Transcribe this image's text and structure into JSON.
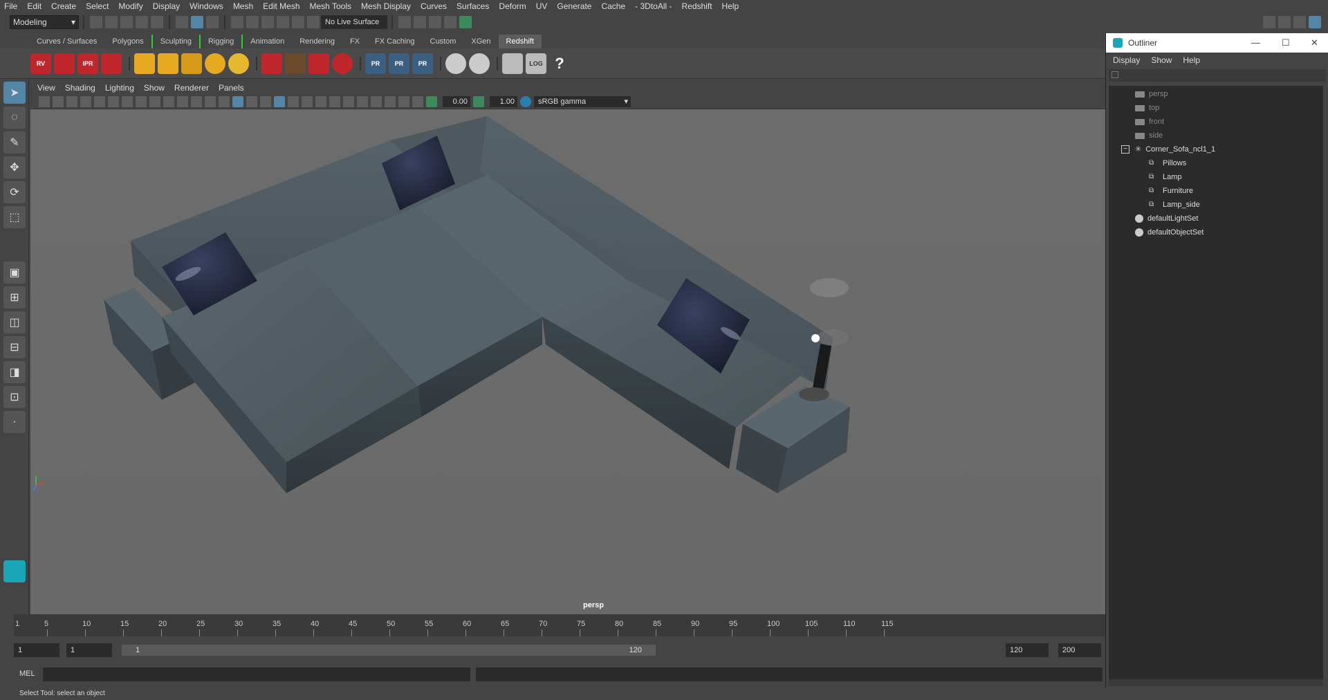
{
  "menubar": [
    "File",
    "Edit",
    "Create",
    "Select",
    "Modify",
    "Display",
    "Windows",
    "Mesh",
    "Edit Mesh",
    "Mesh Tools",
    "Mesh Display",
    "Curves",
    "Surfaces",
    "Deform",
    "UV",
    "Generate",
    "Cache",
    "- 3DtoAll -",
    "Redshift",
    "Help"
  ],
  "status": {
    "mode": "Modeling",
    "live_surface": "No Live Surface"
  },
  "shelf_tabs": [
    "Curves / Surfaces",
    "Polygons",
    "Sculpting",
    "Rigging",
    "Animation",
    "Rendering",
    "FX",
    "FX Caching",
    "Custom",
    "XGen",
    "Redshift"
  ],
  "shelf_active": "Redshift",
  "shelf_icons": {
    "rv": "RV",
    "ipr": "IPR",
    "log": "LOG",
    "help": "?",
    "pr1": "PR",
    "pr2": "PR",
    "pr3": "PR"
  },
  "viewport": {
    "menu": [
      "View",
      "Shading",
      "Lighting",
      "Show",
      "Renderer",
      "Panels"
    ],
    "exposure": "0.00",
    "gamma_value": "1.00",
    "color_space": "sRGB gamma",
    "camera": "persp"
  },
  "timeline": {
    "ticks": [
      "5",
      "10",
      "15",
      "20",
      "25",
      "30",
      "35",
      "40",
      "45",
      "50",
      "55",
      "60",
      "65",
      "70",
      "75",
      "80",
      "85",
      "90",
      "95",
      "100",
      "105",
      "110",
      "115"
    ],
    "current": "1"
  },
  "range": {
    "start": "1",
    "current": "1",
    "range_start": "1",
    "range_end": "120",
    "end": "120",
    "max": "200"
  },
  "mel": {
    "label": "MEL"
  },
  "help_line": "Select Tool: select an object",
  "outliner": {
    "title": "Outliner",
    "menu": [
      "Display",
      "Show",
      "Help"
    ],
    "items": [
      {
        "label": "persp",
        "type": "camera"
      },
      {
        "label": "top",
        "type": "camera"
      },
      {
        "label": "front",
        "type": "camera"
      },
      {
        "label": "side",
        "type": "camera"
      },
      {
        "label": "Corner_Sofa_ncl1_1",
        "type": "group"
      },
      {
        "label": "Pillows",
        "type": "mesh"
      },
      {
        "label": "Lamp",
        "type": "mesh"
      },
      {
        "label": "Furniture",
        "type": "mesh"
      },
      {
        "label": "Lamp_side",
        "type": "mesh"
      },
      {
        "label": "defaultLightSet",
        "type": "set"
      },
      {
        "label": "defaultObjectSet",
        "type": "set"
      }
    ]
  },
  "colors": {
    "accent": "#5285a6",
    "viewport_bg": "#6a6a6a",
    "sofa": "#4f5a61",
    "pillow": "#1f2436"
  }
}
